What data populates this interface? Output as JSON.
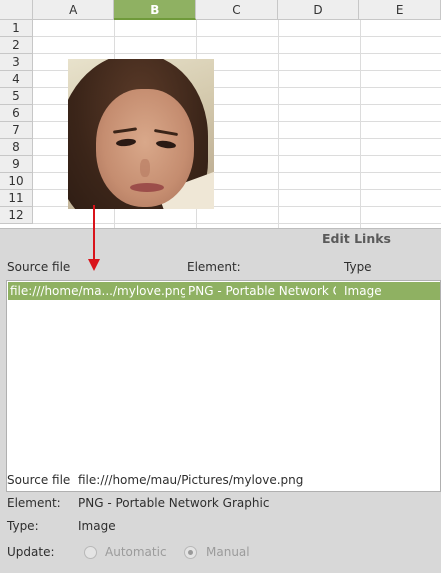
{
  "sheet": {
    "columns": [
      "A",
      "B",
      "C",
      "D",
      "E"
    ],
    "selected_column": "B",
    "rows": [
      "1",
      "2",
      "3",
      "4",
      "5",
      "6",
      "7",
      "8",
      "9",
      "10",
      "11",
      "12"
    ]
  },
  "dialog": {
    "title": "Edit Links",
    "headers": {
      "source": "Source file",
      "element": "Element:",
      "type": "Type"
    },
    "links": [
      {
        "source": "file:///home/ma.../mylove.png",
        "element": "PNG - Portable Network Graphic",
        "type": "Image"
      }
    ],
    "details": {
      "source_label": "Source file",
      "source_value": "file:///home/mau/Pictures/mylove.png",
      "element_label": "Element:",
      "element_value": "PNG - Portable Network Graphic",
      "type_label": "Type:",
      "type_value": "Image",
      "update_label": "Update:",
      "update_options": [
        "Automatic",
        "Manual"
      ],
      "update_selected": "Manual"
    }
  },
  "colors": {
    "selection": "#8fb162",
    "arrow": "#d9141b",
    "dialog_bg": "#d8d8d8"
  },
  "icons": [
    "photo-image",
    "red-arrow-annotation"
  ]
}
